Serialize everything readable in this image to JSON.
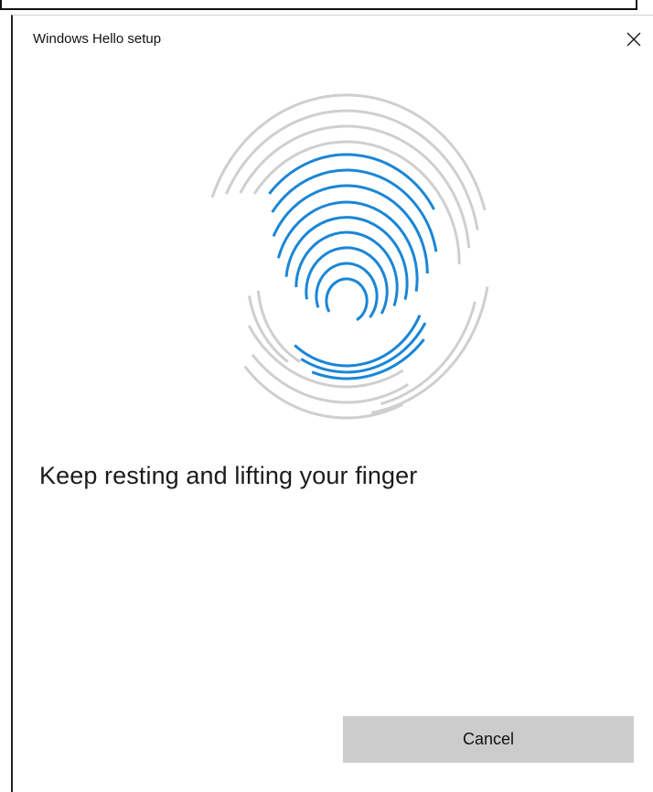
{
  "window": {
    "title": "Windows Hello setup",
    "close_icon": "close-icon"
  },
  "fingerprint": {
    "icon": "fingerprint-icon",
    "progress_color": "#1a86d6",
    "pending_color": "#cfcfcf"
  },
  "main": {
    "instruction": "Keep resting and lifting your finger"
  },
  "actions": {
    "cancel_label": "Cancel"
  }
}
